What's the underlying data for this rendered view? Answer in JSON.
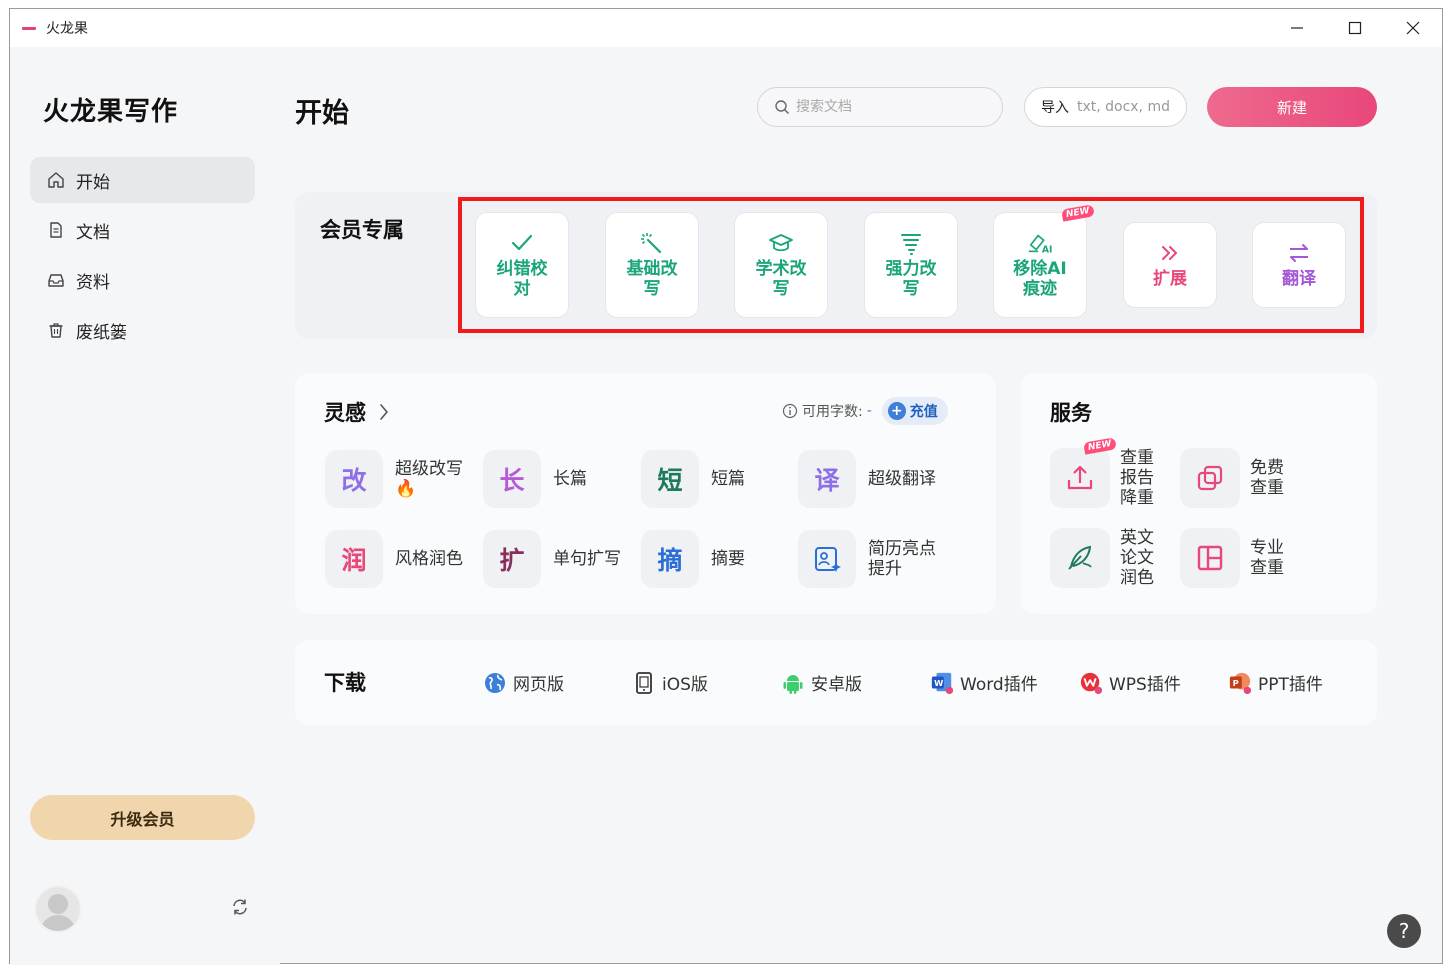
{
  "window": {
    "title": "火龙果"
  },
  "sidebar": {
    "brand": "火龙果写作",
    "nav": [
      {
        "label": "开始",
        "icon": "home-icon"
      },
      {
        "label": "文档",
        "icon": "document-icon"
      },
      {
        "label": "资料",
        "icon": "inbox-icon"
      },
      {
        "label": "废纸篓",
        "icon": "trash-icon"
      }
    ],
    "upgrade_label": "升级会员"
  },
  "header": {
    "title": "开始",
    "search_placeholder": "搜索文档",
    "import_label": "导入",
    "import_hint": "txt, docx, md",
    "new_label": "新建"
  },
  "vip": {
    "title": "会员专属",
    "badge": "NEW",
    "tools": [
      {
        "label": "纠错校对",
        "icon": "check-icon"
      },
      {
        "label": "基础改写",
        "icon": "magic-wand-icon"
      },
      {
        "label": "学术改写",
        "icon": "graduation-cap-icon"
      },
      {
        "label": "强力改写",
        "icon": "tornado-icon"
      },
      {
        "label": "移除AI痕迹",
        "icon": "ai-eraser-icon"
      },
      {
        "label": "扩展",
        "icon": "double-chevron-right-icon"
      },
      {
        "label": "翻译",
        "icon": "swap-arrows-icon"
      }
    ]
  },
  "inspiration": {
    "title": "灵感",
    "quota_label": "可用字数:",
    "quota_value": "-",
    "recharge_label": "充值",
    "items": [
      {
        "glyph": "改",
        "label": "超级改写🔥",
        "color": "#8f6fe8"
      },
      {
        "glyph": "长",
        "label": "长篇",
        "color": "#b65ad6"
      },
      {
        "glyph": "短",
        "label": "短篇",
        "color": "#1e7a5a"
      },
      {
        "glyph": "译",
        "label": "超级翻译",
        "color": "#8f6fe8"
      },
      {
        "glyph": "润",
        "label": "风格润色",
        "color": "#e8477a"
      },
      {
        "glyph": "扩",
        "label": "单句扩写",
        "color": "#8a2f5c"
      },
      {
        "glyph": "摘",
        "label": "摘要",
        "color": "#2a6fd6"
      },
      {
        "glyph": "",
        "label": "简历亮点提升",
        "color": "#2a6fd6"
      }
    ]
  },
  "services": {
    "title": "服务",
    "badge": "NEW",
    "items": [
      {
        "label": "查重报告降重",
        "icon": "upload-icon"
      },
      {
        "label": "免费查重",
        "icon": "copy-icon"
      },
      {
        "label": "英文论文润色",
        "icon": "quill-icon"
      },
      {
        "label": "专业查重",
        "icon": "layout-icon"
      }
    ]
  },
  "downloads": {
    "title": "下载",
    "items": [
      {
        "label": "网页版",
        "icon": "globe-icon"
      },
      {
        "label": "iOS版",
        "icon": "phone-icon"
      },
      {
        "label": "安卓版",
        "icon": "android-icon"
      },
      {
        "label": "Word插件",
        "icon": "word-icon"
      },
      {
        "label": "WPS插件",
        "icon": "wps-icon"
      },
      {
        "label": "PPT插件",
        "icon": "ppt-icon"
      }
    ]
  },
  "help_label": "?"
}
